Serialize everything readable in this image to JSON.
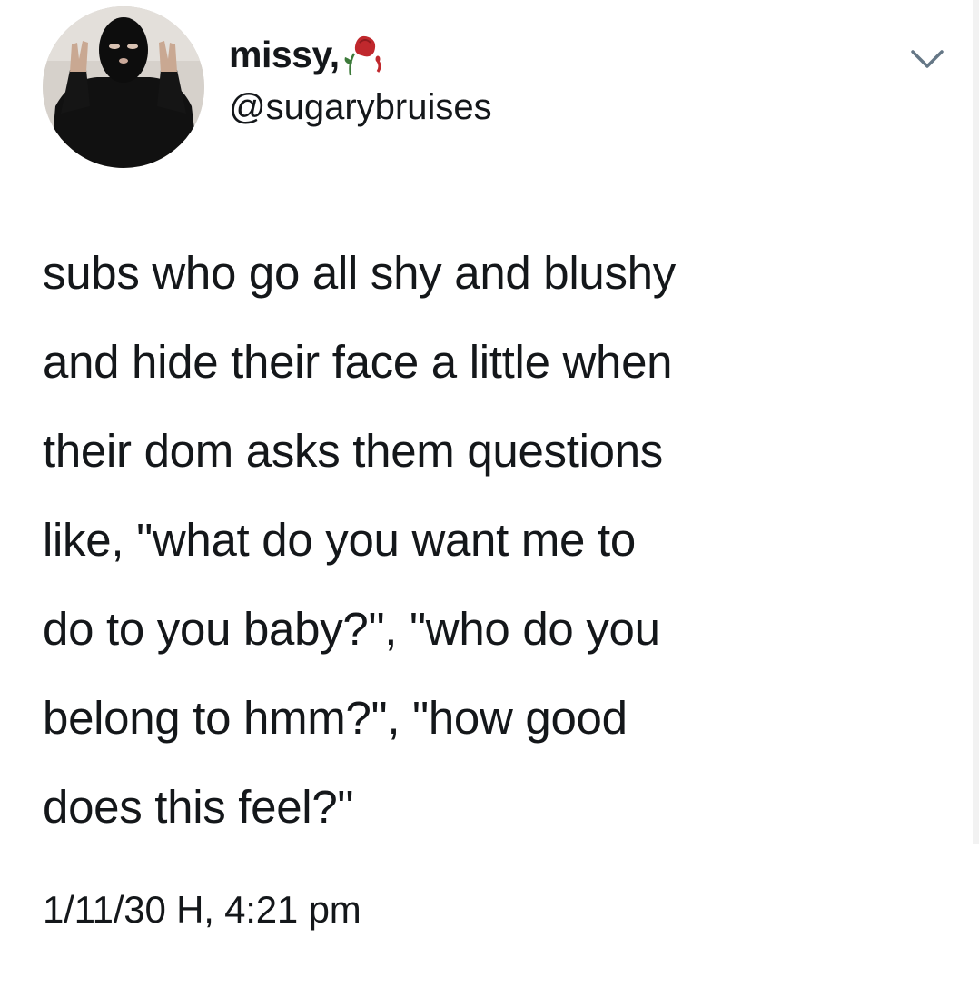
{
  "tweet": {
    "author": {
      "display_name": "missy,",
      "name_emoji_icon": "wilted-rose-icon",
      "handle": "@sugarybruises",
      "avatar_icon": "avatar-photo"
    },
    "menu_icon": "chevron-down-icon",
    "text_lines": [
      "subs who go all shy and blushy",
      "and hide their face a little when",
      "their dom asks them questions",
      "like, \"what do you want me to",
      "do to you baby?\", \"who do you",
      "belong to hmm?\", \"how good",
      "does this feel?\""
    ],
    "timestamp": "1/11/30 H, 4:21 pm"
  },
  "colors": {
    "text": "#14171a",
    "background": "#ffffff",
    "chevron": "#657786",
    "rose": "#c0282d"
  }
}
